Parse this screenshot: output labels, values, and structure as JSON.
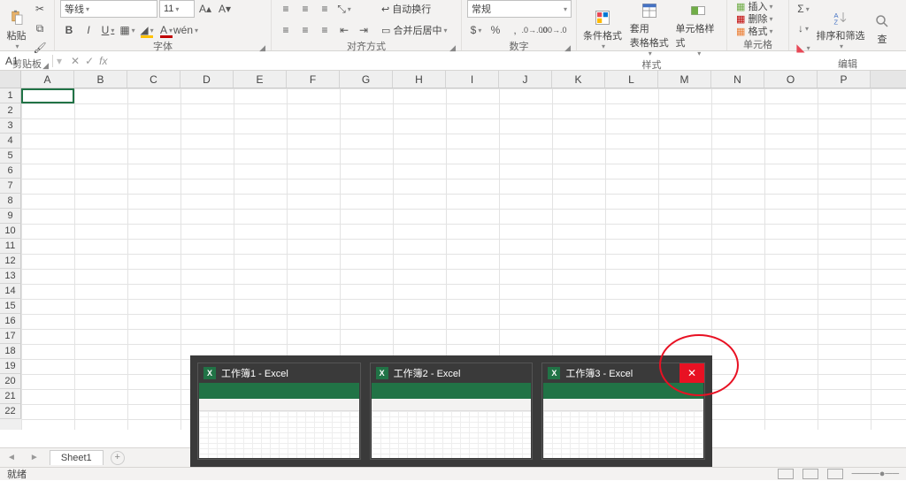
{
  "ribbon": {
    "clipboard": {
      "paste": "粘贴",
      "label": "剪贴板"
    },
    "font": {
      "name": "等线",
      "size": "11",
      "bold": "B",
      "italic": "I",
      "underline": "U",
      "label": "字体"
    },
    "align": {
      "wrap": "自动换行",
      "merge": "合并后居中",
      "label": "对齐方式"
    },
    "number": {
      "format": "常规",
      "label": "数字"
    },
    "styles": {
      "cond": "条件格式",
      "table": "套用\n表格格式",
      "cell": "单元格样式",
      "label": "样式"
    },
    "cells": {
      "insert": "插入",
      "delete": "删除",
      "format": "格式",
      "label": "单元格"
    },
    "editing": {
      "sort": "排序和筛选",
      "find": "查",
      "label": "编辑"
    }
  },
  "formula_bar": {
    "name_box": "A1",
    "fx": "fx"
  },
  "columns": [
    "A",
    "B",
    "C",
    "D",
    "E",
    "F",
    "G",
    "H",
    "I",
    "J",
    "K",
    "L",
    "M",
    "N",
    "O",
    "P"
  ],
  "rows": [
    "1",
    "2",
    "3",
    "4",
    "5",
    "6",
    "7",
    "8",
    "9",
    "10",
    "11",
    "12",
    "13",
    "14",
    "15",
    "16",
    "17",
    "18",
    "19",
    "20",
    "21",
    "22"
  ],
  "sheet": {
    "tab": "Sheet1",
    "add": "+"
  },
  "status": {
    "ready": "就绪"
  },
  "previews": [
    {
      "title": "工作簿1 - Excel"
    },
    {
      "title": "工作簿2 - Excel"
    },
    {
      "title": "工作簿3 - Excel",
      "hasClose": true
    }
  ]
}
